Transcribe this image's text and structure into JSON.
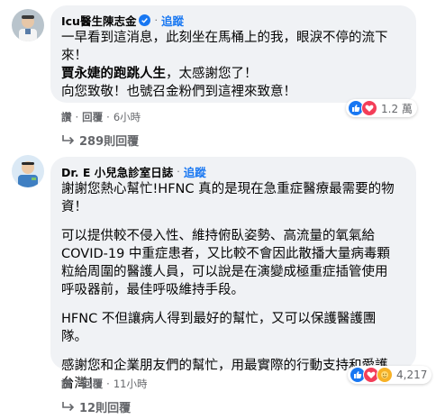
{
  "comments": [
    {
      "author": "Icu醫生陳志金",
      "verified": true,
      "follow_label": "追蹤",
      "paragraphs": [
        {
          "lines": [
            "一早看到這消息，此刻坐在馬桶上的我，眼淚不停的流下",
            "來！"
          ]
        },
        {
          "bold_prefix": "賈永婕的跑跳人生",
          "rest": "，太感謝您了！"
        },
        {
          "lines": [
            "向您致敬！也號召金粉們到這裡來致意！"
          ]
        }
      ],
      "actions": {
        "like": "讚",
        "reply": "回覆",
        "time": "6小時"
      },
      "reaction_count": "1.2 萬",
      "replies_label": "289則回覆"
    },
    {
      "author": "Dr. E 小兒急診室日誌",
      "verified": false,
      "follow_label": "追蹤",
      "paragraphs": [
        {
          "lines": [
            "謝謝您熱心幫忙!HFNC 真的是現在急重症醫療最需要的物",
            "資！"
          ]
        },
        {
          "lines": [
            "可以提供較不侵入性、維持俯臥姿勢、高流量的氧氣給",
            "COVID-19 中重症患者，又比較不會因此散播大量病毒顆",
            "粒給周圍的醫護人員，可以說是在演變成極重症插管使用",
            "呼吸器前，最佳呼吸維持手段。"
          ]
        },
        {
          "lines": [
            "HFNC 不但讓病人得到最好的幫忙，又可以保護醫護團",
            "隊。"
          ]
        },
        {
          "lines": [
            "感謝您和企業朋友們的幫忙，用最實際的行動支持和愛護",
            "台灣！"
          ]
        }
      ],
      "actions": {
        "like": "讚",
        "reply": "回覆",
        "time": "11小時"
      },
      "reaction_count": "4,217",
      "replies_label": "12則回覆"
    }
  ],
  "colors": {
    "link": "#1877f2",
    "bubble": "#f0f2f5",
    "muted": "#65676b",
    "like": "#1877f2",
    "love": "#f33e58"
  },
  "icons": [
    "verified-badge-icon",
    "like-reaction-icon",
    "love-reaction-icon",
    "care-reaction-icon",
    "reply-arrow-icon"
  ]
}
